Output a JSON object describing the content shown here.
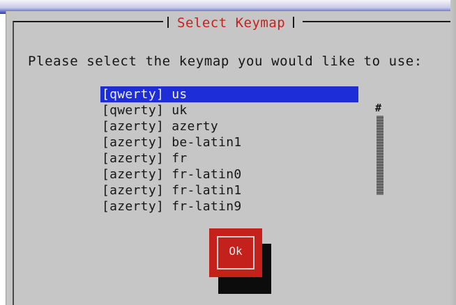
{
  "dialog": {
    "title": "Select Keymap",
    "prompt": "Please select the keymap you would like to use:",
    "keymaps": [
      {
        "label": "[qwerty] us",
        "selected": true
      },
      {
        "label": "[qwerty] uk",
        "selected": false
      },
      {
        "label": "[azerty] azerty",
        "selected": false
      },
      {
        "label": "[azerty] be-latin1",
        "selected": false
      },
      {
        "label": "[azerty] fr",
        "selected": false
      },
      {
        "label": "[azerty] fr-latin0",
        "selected": false
      },
      {
        "label": "[azerty] fr-latin1",
        "selected": false
      },
      {
        "label": "[azerty] fr-latin9",
        "selected": false
      }
    ],
    "scroll_marker": "#",
    "ok_label": "Ok"
  },
  "colors": {
    "dialog_background": "#c6c6c6",
    "title_text": "#c8201c",
    "selection_background": "#1d2ed8",
    "button_background": "#c4201c",
    "top_band": "#2e3bb8"
  }
}
